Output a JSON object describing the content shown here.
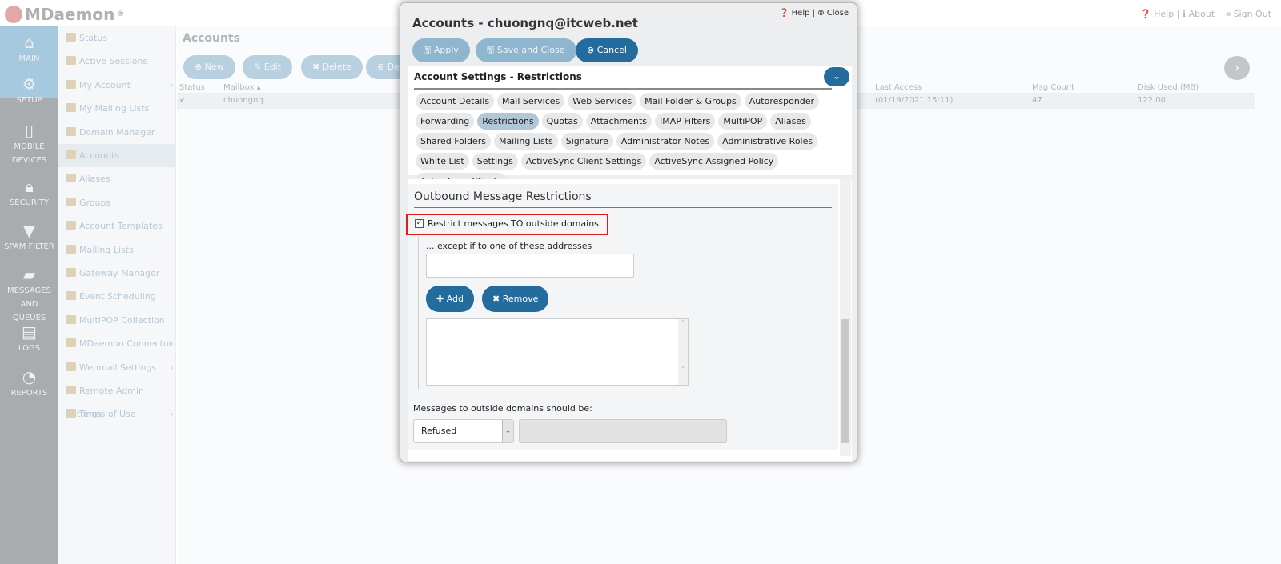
{
  "app": {
    "name": "MDaemon",
    "registered": "®"
  },
  "top_links": {
    "help": "Help",
    "about": "About",
    "sign_out": "Sign Out"
  },
  "main_nav": [
    {
      "label": "MAIN",
      "icon": "home-icon",
      "active": true
    },
    {
      "label": "SETUP",
      "icon": "gears-icon"
    },
    {
      "label": "MOBILE DEVICES",
      "icon": "mobile-icon"
    },
    {
      "label": "SECURITY",
      "icon": "lock-icon"
    },
    {
      "label": "SPAM FILTER",
      "icon": "filter-icon"
    },
    {
      "label": "MESSAGES AND QUEUES",
      "icon": "folder-icon"
    },
    {
      "label": "LOGS",
      "icon": "file-icon"
    },
    {
      "label": "REPORTS",
      "icon": "dashboard-icon"
    }
  ],
  "sub_nav": [
    {
      "label": "Status"
    },
    {
      "label": "Active Sessions"
    },
    {
      "label": "My Account",
      "submenu": true
    },
    {
      "label": "My Mailing Lists"
    },
    {
      "label": "Domain Manager"
    },
    {
      "label": "Accounts",
      "active": true
    },
    {
      "label": "Aliases"
    },
    {
      "label": "Groups"
    },
    {
      "label": "Account Templates"
    },
    {
      "label": "Mailing Lists"
    },
    {
      "label": "Gateway Manager"
    },
    {
      "label": "Event Scheduling"
    },
    {
      "label": "MultiPOP Collection"
    },
    {
      "label": "MDaemon Connector",
      "submenu": true
    },
    {
      "label": "Webmail Settings",
      "submenu": true
    },
    {
      "label": "Remote Admin Settings",
      "submenu": true
    },
    {
      "label": "Terms of Use"
    }
  ],
  "accounts": {
    "title": "Accounts",
    "toolbar": {
      "new": "New",
      "edit": "Edit",
      "delete": "Delete",
      "more": "De"
    },
    "columns": {
      "status": "Status",
      "mailbox": "Mailbox",
      "last_access": "Last Access",
      "msg_count": "Msg Count",
      "disk_used": "Disk Used (MB)"
    },
    "rows": [
      {
        "status": "✔",
        "mailbox": "chuongnq",
        "last_access": "(01/19/2021 15:11)",
        "msg_count": "47",
        "disk_used": "122.00"
      }
    ]
  },
  "modal": {
    "title": "Accounts - chuongnq@itcweb.net",
    "help": "Help",
    "close": "Close",
    "apply": "Apply",
    "save_close": "Save and Close",
    "cancel": "Cancel",
    "settings_title": "Account Settings - Restrictions",
    "tabs": [
      "Account Details",
      "Mail Services",
      "Web Services",
      "Mail Folder & Groups",
      "Autoresponder",
      "Forwarding",
      "Restrictions",
      "Quotas",
      "Attachments",
      "IMAP Filters",
      "MultiPOP",
      "Aliases",
      "Shared Folders",
      "Mailing Lists",
      "Signature",
      "Administrator Notes",
      "Administrative Roles",
      "White List",
      "Settings",
      "ActiveSync Client Settings",
      "ActiveSync Assigned Policy",
      "ActiveSync Clients"
    ],
    "selected_tab": "Restrictions",
    "section_title": "Outbound Message Restrictions",
    "restrict_label": "Restrict messages TO outside domains",
    "restrict_checked": true,
    "except_label": "... except if to one of these addresses",
    "except_value": "",
    "add": "Add",
    "remove": "Remove",
    "disposition_label": "Messages to outside domains should be:",
    "disposition_value": "Refused"
  },
  "colors": {
    "accent": "#246c9e",
    "highlight": "#e01b1b"
  }
}
